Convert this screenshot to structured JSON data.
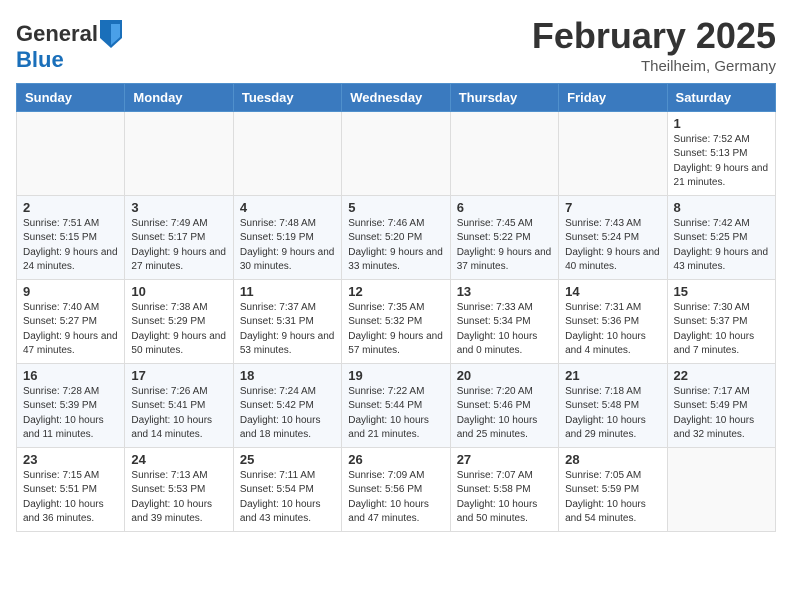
{
  "header": {
    "logo_general": "General",
    "logo_blue": "Blue",
    "month_title": "February 2025",
    "location": "Theilheim, Germany"
  },
  "weekdays": [
    "Sunday",
    "Monday",
    "Tuesday",
    "Wednesday",
    "Thursday",
    "Friday",
    "Saturday"
  ],
  "weeks": [
    [
      {
        "day": "",
        "info": ""
      },
      {
        "day": "",
        "info": ""
      },
      {
        "day": "",
        "info": ""
      },
      {
        "day": "",
        "info": ""
      },
      {
        "day": "",
        "info": ""
      },
      {
        "day": "",
        "info": ""
      },
      {
        "day": "1",
        "info": "Sunrise: 7:52 AM\nSunset: 5:13 PM\nDaylight: 9 hours and 21 minutes."
      }
    ],
    [
      {
        "day": "2",
        "info": "Sunrise: 7:51 AM\nSunset: 5:15 PM\nDaylight: 9 hours and 24 minutes."
      },
      {
        "day": "3",
        "info": "Sunrise: 7:49 AM\nSunset: 5:17 PM\nDaylight: 9 hours and 27 minutes."
      },
      {
        "day": "4",
        "info": "Sunrise: 7:48 AM\nSunset: 5:19 PM\nDaylight: 9 hours and 30 minutes."
      },
      {
        "day": "5",
        "info": "Sunrise: 7:46 AM\nSunset: 5:20 PM\nDaylight: 9 hours and 33 minutes."
      },
      {
        "day": "6",
        "info": "Sunrise: 7:45 AM\nSunset: 5:22 PM\nDaylight: 9 hours and 37 minutes."
      },
      {
        "day": "7",
        "info": "Sunrise: 7:43 AM\nSunset: 5:24 PM\nDaylight: 9 hours and 40 minutes."
      },
      {
        "day": "8",
        "info": "Sunrise: 7:42 AM\nSunset: 5:25 PM\nDaylight: 9 hours and 43 minutes."
      }
    ],
    [
      {
        "day": "9",
        "info": "Sunrise: 7:40 AM\nSunset: 5:27 PM\nDaylight: 9 hours and 47 minutes."
      },
      {
        "day": "10",
        "info": "Sunrise: 7:38 AM\nSunset: 5:29 PM\nDaylight: 9 hours and 50 minutes."
      },
      {
        "day": "11",
        "info": "Sunrise: 7:37 AM\nSunset: 5:31 PM\nDaylight: 9 hours and 53 minutes."
      },
      {
        "day": "12",
        "info": "Sunrise: 7:35 AM\nSunset: 5:32 PM\nDaylight: 9 hours and 57 minutes."
      },
      {
        "day": "13",
        "info": "Sunrise: 7:33 AM\nSunset: 5:34 PM\nDaylight: 10 hours and 0 minutes."
      },
      {
        "day": "14",
        "info": "Sunrise: 7:31 AM\nSunset: 5:36 PM\nDaylight: 10 hours and 4 minutes."
      },
      {
        "day": "15",
        "info": "Sunrise: 7:30 AM\nSunset: 5:37 PM\nDaylight: 10 hours and 7 minutes."
      }
    ],
    [
      {
        "day": "16",
        "info": "Sunrise: 7:28 AM\nSunset: 5:39 PM\nDaylight: 10 hours and 11 minutes."
      },
      {
        "day": "17",
        "info": "Sunrise: 7:26 AM\nSunset: 5:41 PM\nDaylight: 10 hours and 14 minutes."
      },
      {
        "day": "18",
        "info": "Sunrise: 7:24 AM\nSunset: 5:42 PM\nDaylight: 10 hours and 18 minutes."
      },
      {
        "day": "19",
        "info": "Sunrise: 7:22 AM\nSunset: 5:44 PM\nDaylight: 10 hours and 21 minutes."
      },
      {
        "day": "20",
        "info": "Sunrise: 7:20 AM\nSunset: 5:46 PM\nDaylight: 10 hours and 25 minutes."
      },
      {
        "day": "21",
        "info": "Sunrise: 7:18 AM\nSunset: 5:48 PM\nDaylight: 10 hours and 29 minutes."
      },
      {
        "day": "22",
        "info": "Sunrise: 7:17 AM\nSunset: 5:49 PM\nDaylight: 10 hours and 32 minutes."
      }
    ],
    [
      {
        "day": "23",
        "info": "Sunrise: 7:15 AM\nSunset: 5:51 PM\nDaylight: 10 hours and 36 minutes."
      },
      {
        "day": "24",
        "info": "Sunrise: 7:13 AM\nSunset: 5:53 PM\nDaylight: 10 hours and 39 minutes."
      },
      {
        "day": "25",
        "info": "Sunrise: 7:11 AM\nSunset: 5:54 PM\nDaylight: 10 hours and 43 minutes."
      },
      {
        "day": "26",
        "info": "Sunrise: 7:09 AM\nSunset: 5:56 PM\nDaylight: 10 hours and 47 minutes."
      },
      {
        "day": "27",
        "info": "Sunrise: 7:07 AM\nSunset: 5:58 PM\nDaylight: 10 hours and 50 minutes."
      },
      {
        "day": "28",
        "info": "Sunrise: 7:05 AM\nSunset: 5:59 PM\nDaylight: 10 hours and 54 minutes."
      },
      {
        "day": "",
        "info": ""
      }
    ]
  ]
}
